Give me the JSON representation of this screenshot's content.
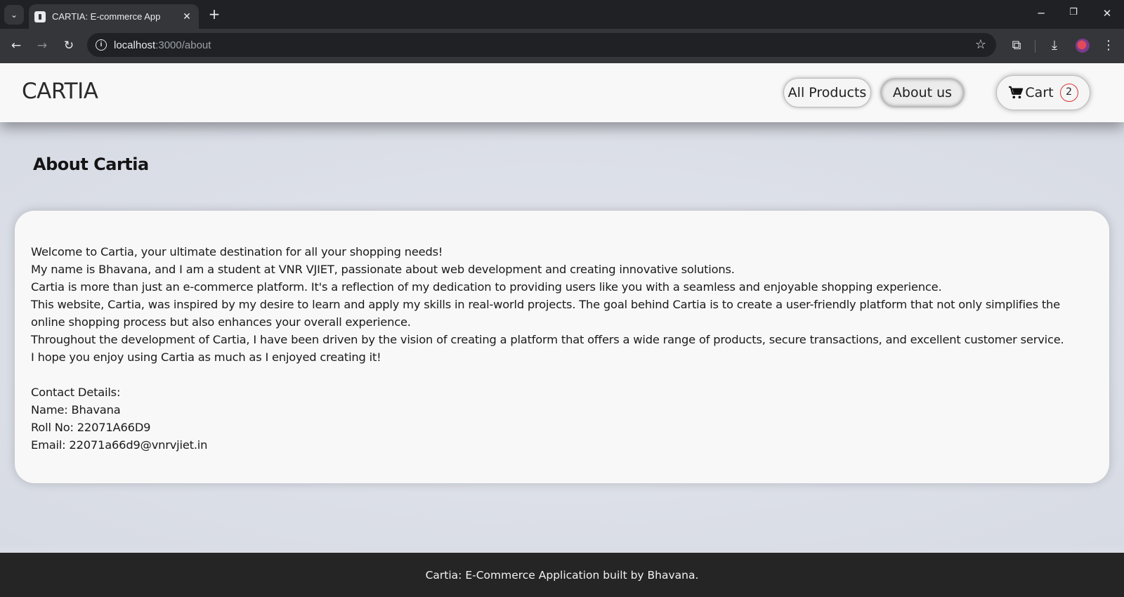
{
  "browser": {
    "tab_title": "CARTIA: E-commerce App",
    "url_host": "localhost",
    "url_path": ":3000/about",
    "window_controls": {
      "minimize": "─",
      "restore": "❐",
      "close": "✕"
    }
  },
  "header": {
    "brand": "CARTIA",
    "nav": {
      "all_products": "All Products",
      "about_us": "About us",
      "cart_label": "Cart",
      "cart_count": "2"
    }
  },
  "main": {
    "title": "About Cartia",
    "paragraphs": [
      "Welcome to Cartia, your ultimate destination for all your shopping needs!",
      "My name is Bhavana, and I am a student at VNR VJIET, passionate about web development and creating innovative solutions.",
      "Cartia is more than just an e-commerce platform. It's a reflection of my dedication to providing users like you with a seamless and enjoyable shopping experience.",
      "This website, Cartia, was inspired by my desire to learn and apply my skills in real-world projects. The goal behind Cartia is to create a user-friendly platform that not only simplifies the online shopping process but also enhances your overall experience.",
      "Throughout the development of Cartia, I have been driven by the vision of creating a platform that offers a wide range of products, secure transactions, and excellent customer service.",
      "I hope you enjoy using Cartia as much as I enjoyed creating it!"
    ],
    "contact": {
      "heading": "Contact Details:",
      "name": "Name: Bhavana",
      "roll": "Roll No: 22071A66D9",
      "email": "Email: 22071a66d9@vnrvjiet.in"
    }
  },
  "footer": {
    "text": "Cartia: E-Commerce Application built by Bhavana."
  }
}
